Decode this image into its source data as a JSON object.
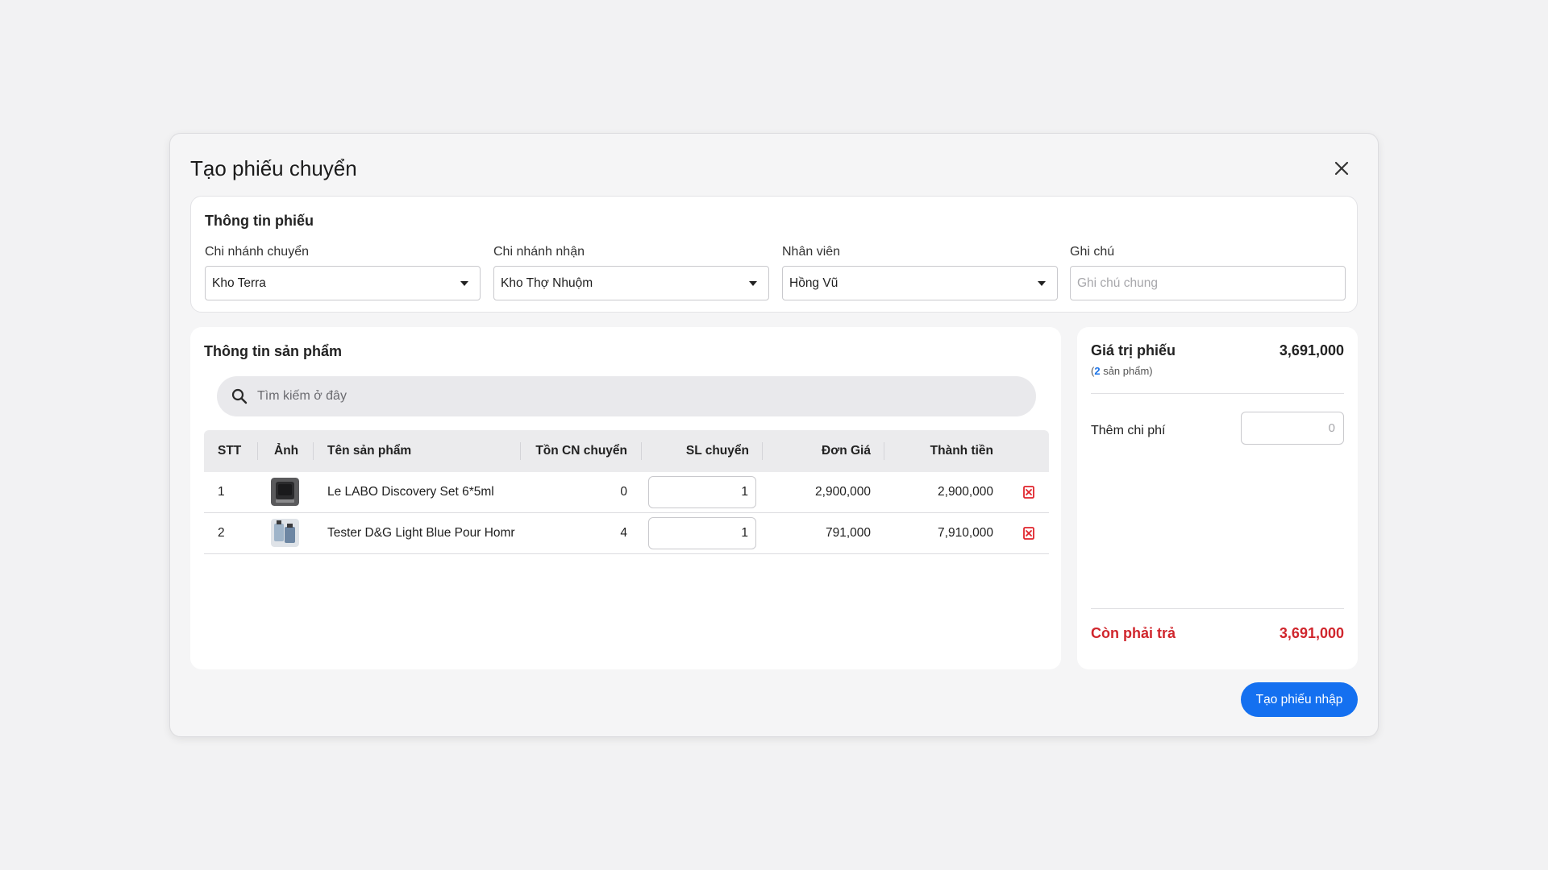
{
  "modal": {
    "title": "Tạo phiếu chuyển",
    "submit_label": "Tạo phiếu nhập"
  },
  "info": {
    "title": "Thông tin phiếu",
    "from_branch": {
      "label": "Chi nhánh chuyển",
      "value": "Kho Terra"
    },
    "to_branch": {
      "label": "Chi nhánh nhận",
      "value": "Kho Thợ Nhuộm"
    },
    "staff": {
      "label": "Nhân viên",
      "value": "Hồng Vũ"
    },
    "note": {
      "label": "Ghi chú",
      "value": "",
      "placeholder": "Ghi chú chung"
    }
  },
  "products": {
    "title": "Thông tin sản phẩm",
    "search_placeholder": "Tìm kiếm ở đây",
    "columns": [
      "STT",
      "Ảnh",
      "Tên sản phẩm",
      "Tồn CN chuyển",
      "SL chuyển",
      "Đơn Giá",
      "Thành tiền"
    ],
    "rows": [
      {
        "stt": "1",
        "name": "Le LABO Discovery Set 6*5ml",
        "stock": "0",
        "qty": "1",
        "price": "2,900,000",
        "total": "2,900,000"
      },
      {
        "stt": "2",
        "name": "Tester D&G Light Blue Pour Homr",
        "stock": "4",
        "qty": "1",
        "price": "791,000",
        "total": "7,910,000"
      }
    ]
  },
  "summary": {
    "title": "Giá trị phiếu",
    "total": "3,691,000",
    "count_open": "(",
    "count_num": "2",
    "count_text": " sản phẩm)",
    "fee_label": "Thêm chi phí",
    "fee_placeholder": "0",
    "remain_label": "Còn phải trả",
    "remain_value": "3,691,000"
  },
  "colors": {
    "primary": "#1470f0",
    "danger": "#d0262d",
    "background": "#f2f2f3"
  }
}
